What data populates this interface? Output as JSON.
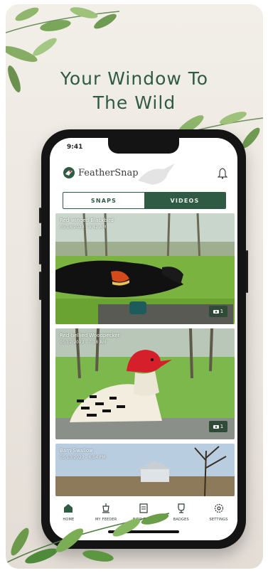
{
  "headline": {
    "line1": "Your Window To",
    "line2": "The Wild"
  },
  "status_bar": {
    "time": "9:41"
  },
  "app": {
    "name": "FeatherSnap"
  },
  "tabs": [
    {
      "label": "SNAPS",
      "active": false
    },
    {
      "label": "VIDEOS",
      "active": true
    }
  ],
  "snaps": [
    {
      "title": "Red-winged Blackbird",
      "date": "05/14/2023 - 9:42 AM",
      "count": "1"
    },
    {
      "title": "Red-bellied Woodpecker",
      "date": "05/12/2023 - 7:18 AM",
      "count": "1"
    },
    {
      "title": "Barn Swallow",
      "date": "05/10/2023 - 6:04 PM",
      "count": ""
    }
  ],
  "bottom_nav": [
    {
      "label": "HOME",
      "icon": "home-icon"
    },
    {
      "label": "MY FEEDER",
      "icon": "feeder-icon"
    },
    {
      "label": "BIRD BOOK",
      "icon": "book-icon"
    },
    {
      "label": "BADGES",
      "icon": "badge-icon"
    },
    {
      "label": "SETTINGS",
      "icon": "gear-icon"
    }
  ],
  "colors": {
    "brand_green": "#2f5a43",
    "background": "#ebe6df",
    "badge": "#2f4b37"
  }
}
